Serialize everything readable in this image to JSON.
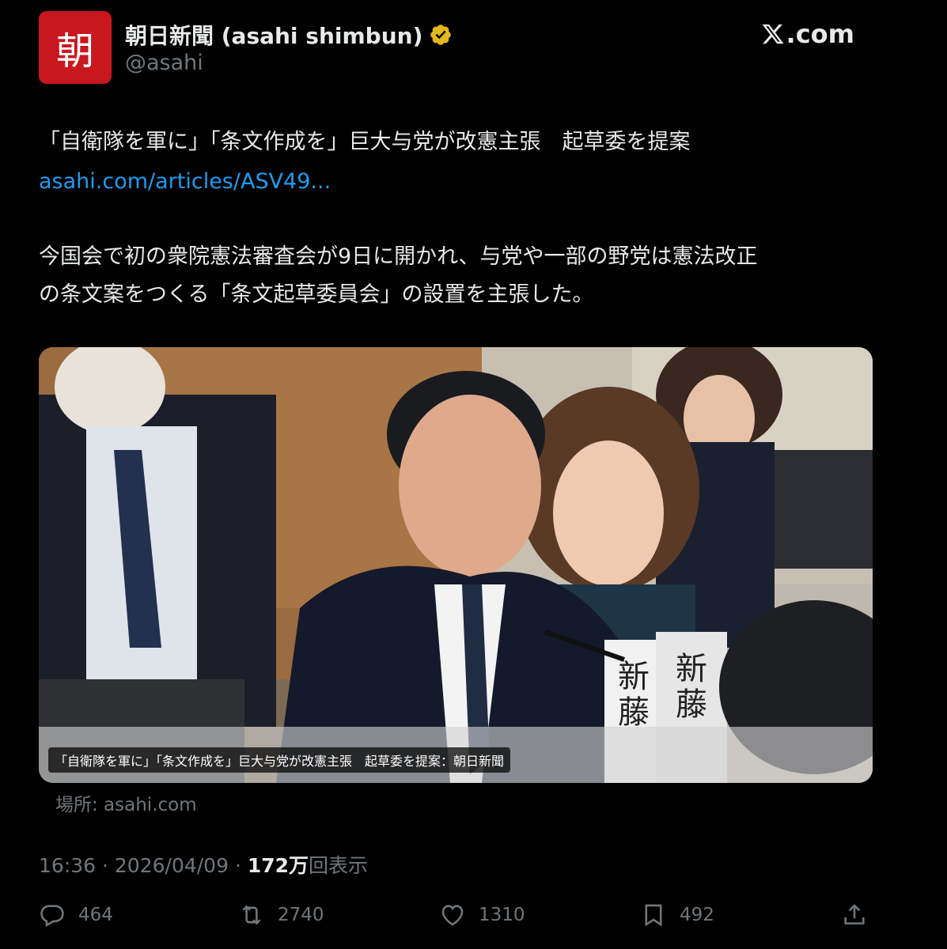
{
  "header": {
    "avatar_text": "朝",
    "display_name": "朝日新聞 (asahi shimbun)",
    "handle": "@asahi",
    "brand": "X.com"
  },
  "post": {
    "headline": "「自衛隊を軍に」「条文作成を」巨大与党が改憲主張　起草委を提案",
    "link": "asahi.com/articles/ASV49...",
    "paragraph_line1": "今国会で初の衆院憲法審査会が9日に開かれ、与党や一部の野党は憲法改正",
    "paragraph_line2": "の条文案をつくる「条文起草委員会」の設置を主張した。"
  },
  "media": {
    "caption": "「自衛隊を軍に」「条文作成を」巨大与党が改憲主張　起草委を提案：朝日新聞",
    "source": "場所: asahi.com"
  },
  "meta": {
    "time": "16:36",
    "date": "2026/04/09",
    "views_count": "172万",
    "views_label": "回表示"
  },
  "actions": {
    "replies": "464",
    "reposts": "2740",
    "likes": "1310",
    "bookmarks": "492"
  },
  "colors": {
    "background": "#000000",
    "text": "#e7e9ea",
    "muted": "#71767b",
    "link": "#1d9bf0",
    "verified": "#e2b719",
    "avatar": "#c8171e"
  }
}
